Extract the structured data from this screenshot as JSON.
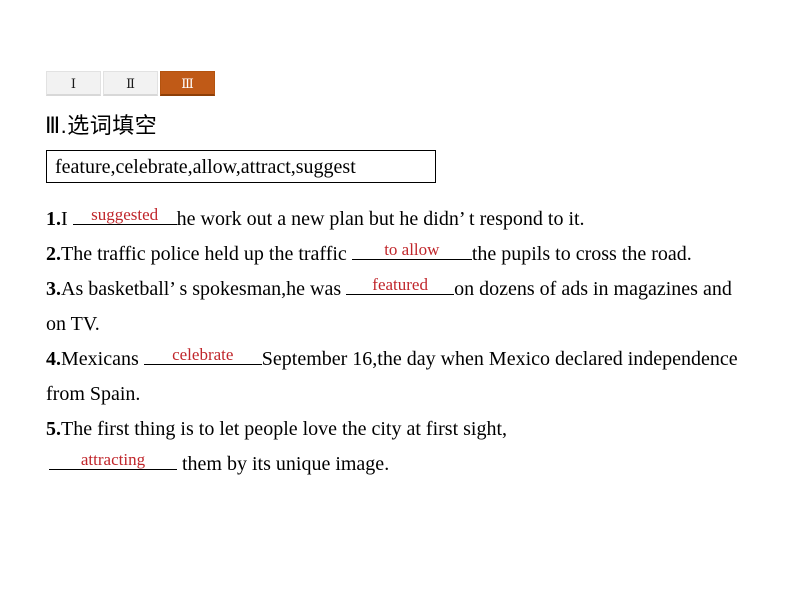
{
  "tabs": [
    {
      "label": "Ⅰ",
      "active": false
    },
    {
      "label": "Ⅱ",
      "active": false
    },
    {
      "label": "Ⅲ",
      "active": true
    }
  ],
  "heading": "Ⅲ.选词填空",
  "word_bank": "feature,celebrate,allow,attract,suggest",
  "colors": {
    "active_tab_bg": "#c05A17",
    "inactive_tab_bg": "#f2f2f2",
    "answer_red": "#c0262b",
    "text": "#000000",
    "page_bg": "#ffffff"
  },
  "questions": [
    {
      "number": "1.",
      "before": "I ",
      "answer": "suggested",
      "after": "he work out a new plan but he didn’ t respond to it."
    },
    {
      "number": "2.",
      "before": "The traffic police held up the traffic ",
      "answer": "to allow",
      "after": "the pupils to cross the road."
    },
    {
      "number": "3.",
      "before": "As basketball’ s spokesman,he was ",
      "answer": "featured",
      "after": "on dozens of ads in magazines and on TV."
    },
    {
      "number": "4.",
      "before": "Mexicans ",
      "answer": "celebrate",
      "after": "September 16,the day when Mexico declared independence from Spain."
    },
    {
      "number": "5.",
      "before": "The first thing is to let people love the city at first sight,",
      "answer": "attracting",
      "after": " them by its unique image."
    }
  ]
}
